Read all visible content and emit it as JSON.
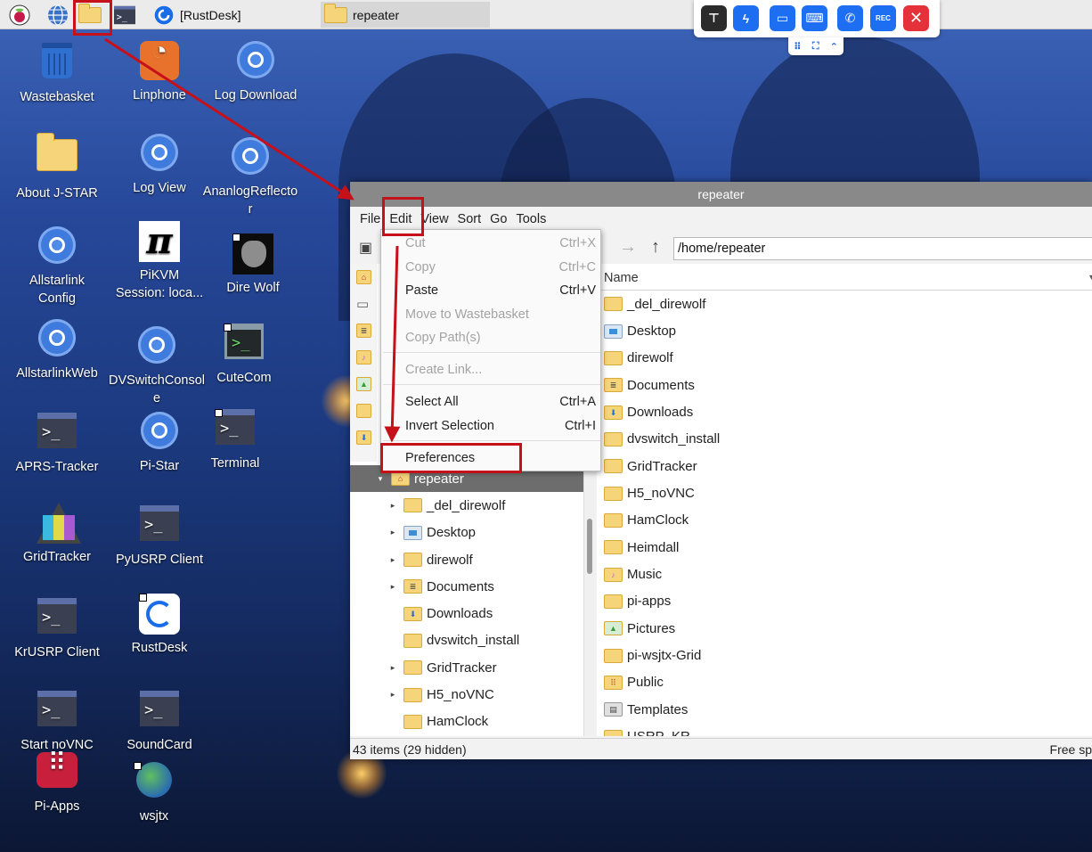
{
  "taskbar": {
    "task_rustdesk": "[RustDesk]",
    "task_repeater": "repeater"
  },
  "remote_toolbar": {
    "rec_label": "REC",
    "colors": {
      "dark": "#2b2b2b",
      "blue": "#1e6ef2",
      "red": "#e5323a"
    }
  },
  "desktop": {
    "icons": [
      {
        "label": "Wastebasket",
        "icon": "wastebasket-icon"
      },
      {
        "label": "Linphone",
        "icon": "linphone-icon"
      },
      {
        "label": "Log Download",
        "icon": "chromium-icon"
      },
      {
        "label": "About J-STAR",
        "icon": "folder-icon"
      },
      {
        "label": "Log View",
        "icon": "chromium-icon"
      },
      {
        "label": "AnanlogReflector",
        "icon": "chromium-icon"
      },
      {
        "label": "Allstarlink Config",
        "icon": "chromium-icon"
      },
      {
        "label": "PiKVM Session: loca...",
        "icon": "pi-icon"
      },
      {
        "label": "Dire Wolf",
        "icon": "wolf-icon"
      },
      {
        "label": "AllstarlinkWeb",
        "icon": "chromium-icon"
      },
      {
        "label": "DVSwitchConsole",
        "icon": "chromium-icon"
      },
      {
        "label": "CuteCom",
        "icon": "terminal-icon"
      },
      {
        "label": "APRS-Tracker",
        "icon": "terminal-icon"
      },
      {
        "label": "Pi-Star",
        "icon": "chromium-icon"
      },
      {
        "label": "Terminal",
        "icon": "terminal-icon"
      },
      {
        "label": "GridTracker",
        "icon": "gridtracker-icon"
      },
      {
        "label": "PyUSRP Client",
        "icon": "terminal-icon"
      },
      {
        "label": "KrUSRP Client",
        "icon": "terminal-icon"
      },
      {
        "label": "RustDesk",
        "icon": "rustdesk-icon"
      },
      {
        "label": "Start noVNC",
        "icon": "terminal-icon"
      },
      {
        "label": "SoundCard",
        "icon": "terminal-icon"
      },
      {
        "label": "Pi-Apps",
        "icon": "pi-apps-icon"
      },
      {
        "label": "wsjtx",
        "icon": "wsjtx-icon"
      }
    ]
  },
  "file_manager": {
    "title": "repeater",
    "menu": [
      "File",
      "Edit",
      "View",
      "Sort",
      "Go",
      "Tools"
    ],
    "path": "/home/repeater",
    "column_name": "Name",
    "tree": [
      {
        "label": "repeater",
        "icon": "home",
        "expander": "▾",
        "selected": true
      },
      {
        "label": "_del_direwolf",
        "icon": "folder",
        "expander": "▸"
      },
      {
        "label": "Desktop",
        "icon": "desk",
        "expander": "▸"
      },
      {
        "label": "direwolf",
        "icon": "folder",
        "expander": "▸"
      },
      {
        "label": "Documents",
        "icon": "docs",
        "expander": "▸"
      },
      {
        "label": "Downloads",
        "icon": "dl",
        "expander": ""
      },
      {
        "label": "dvswitch_install",
        "icon": "folder",
        "expander": ""
      },
      {
        "label": "GridTracker",
        "icon": "folder",
        "expander": "▸"
      },
      {
        "label": "H5_noVNC",
        "icon": "folder",
        "expander": "▸"
      },
      {
        "label": "HamClock",
        "icon": "folder",
        "expander": ""
      }
    ],
    "files": [
      {
        "name": "_del_direwolf",
        "icon": "folder"
      },
      {
        "name": "Desktop",
        "icon": "desk"
      },
      {
        "name": "direwolf",
        "icon": "folder"
      },
      {
        "name": "Documents",
        "icon": "docs"
      },
      {
        "name": "Downloads",
        "icon": "dl"
      },
      {
        "name": "dvswitch_install",
        "icon": "folder"
      },
      {
        "name": "GridTracker",
        "icon": "folder"
      },
      {
        "name": "H5_noVNC",
        "icon": "folder"
      },
      {
        "name": "HamClock",
        "icon": "folder"
      },
      {
        "name": "Heimdall",
        "icon": "folder"
      },
      {
        "name": "Music",
        "icon": "music"
      },
      {
        "name": "pi-apps",
        "icon": "folder"
      },
      {
        "name": "Pictures",
        "icon": "pics"
      },
      {
        "name": "pi-wsjtx-Grid",
        "icon": "folder"
      },
      {
        "name": "Public",
        "icon": "pub"
      },
      {
        "name": "Templates",
        "icon": "tpl"
      },
      {
        "name": "USRP_KR",
        "icon": "folder"
      }
    ],
    "status_left": "43 items (29 hidden)",
    "status_right": "Free sp"
  },
  "edit_menu": {
    "items": [
      {
        "label": "Cut",
        "accel": "Ctrl+X",
        "disabled": true
      },
      {
        "label": "Copy",
        "accel": "Ctrl+C",
        "disabled": true
      },
      {
        "label": "Paste",
        "accel": "Ctrl+V",
        "disabled": false
      },
      {
        "label": "Move to Wastebasket",
        "accel": "",
        "disabled": true
      },
      {
        "label": "Copy Path(s)",
        "accel": "",
        "disabled": true
      },
      {
        "label": "Create Link...",
        "accel": "",
        "disabled": true
      },
      {
        "label": "Select All",
        "accel": "Ctrl+A",
        "disabled": false
      },
      {
        "label": "Invert Selection",
        "accel": "Ctrl+I",
        "disabled": false
      },
      {
        "label": "Preferences",
        "accel": "",
        "disabled": false
      }
    ]
  },
  "annotation": {
    "highlight_color": "#c6101a"
  }
}
